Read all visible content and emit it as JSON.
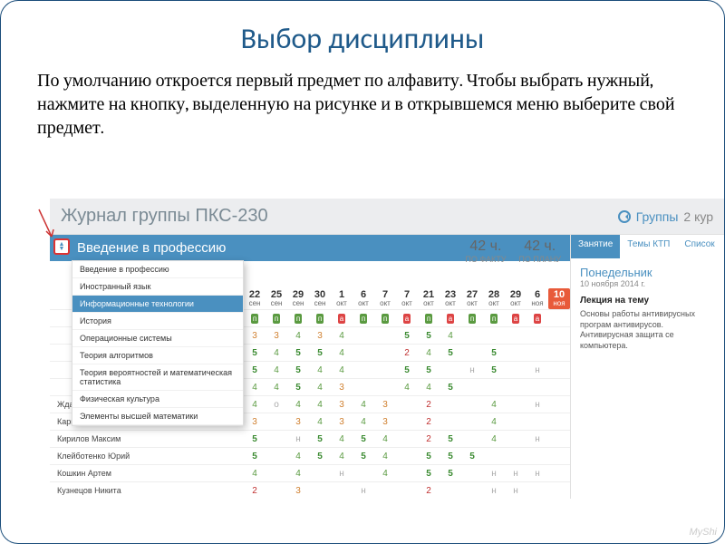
{
  "slide": {
    "title": "Выбор дисциплины",
    "description": "По умолчанию откроется первый предмет по алфавиту. Чтобы выбрать нужный, нажмите на кнопку, выделенную на рисунке и в открывшемся меню выберите свой предмет."
  },
  "app": {
    "journal_title": "Журнал группы ПКС-230",
    "breadcrumb_groups": "Группы",
    "breadcrumb_course": "2 кур",
    "subject_bar": "Введение в профессию",
    "hours": {
      "fact_value": "42 ч.",
      "fact_label": "ПО ФАКТУ",
      "plan_value": "42 ч.",
      "plan_label": "ПО ПЛАНУ"
    }
  },
  "dropdown": {
    "items": [
      {
        "label": "Введение в профессию",
        "selected": false
      },
      {
        "label": "Иностранный язык",
        "selected": false
      },
      {
        "label": "Информационные технологии",
        "selected": true
      },
      {
        "label": "История",
        "selected": false
      },
      {
        "label": "Операционные системы",
        "selected": false
      },
      {
        "label": "Теория алгоритмов",
        "selected": false
      },
      {
        "label": "Теория вероятностей и математическая статистика",
        "selected": false
      },
      {
        "label": "Физическая культура",
        "selected": false
      },
      {
        "label": "Элементы высшей математики",
        "selected": false
      }
    ]
  },
  "dates": [
    {
      "d": "22",
      "m": "сен"
    },
    {
      "d": "25",
      "m": "сен"
    },
    {
      "d": "29",
      "m": "сен"
    },
    {
      "d": "30",
      "m": "сен"
    },
    {
      "d": "1",
      "m": "окт"
    },
    {
      "d": "6",
      "m": "окт"
    },
    {
      "d": "7",
      "m": "окт"
    },
    {
      "d": "7",
      "m": "окт"
    },
    {
      "d": "21",
      "m": "окт"
    },
    {
      "d": "23",
      "m": "окт"
    },
    {
      "d": "27",
      "m": "окт"
    },
    {
      "d": "28",
      "m": "окт"
    },
    {
      "d": "29",
      "m": "окт"
    },
    {
      "d": "6",
      "m": "ноя"
    },
    {
      "d": "10",
      "m": "ноя",
      "hl": true
    }
  ],
  "flag_row": [
    "1",
    "1",
    "1",
    "1",
    "0",
    "1",
    "1",
    "0",
    "1",
    "0",
    "1",
    "1",
    "0",
    "0"
  ],
  "grade_rows": [
    {
      "name": "",
      "cells": [
        "3",
        "3",
        "4",
        "3",
        "4",
        "",
        "",
        "5",
        "5",
        "4",
        "",
        "",
        "",
        ""
      ]
    },
    {
      "name": "",
      "cells": [
        "5",
        "4",
        "5",
        "5",
        "4",
        "",
        "",
        "2",
        "4",
        "5",
        "",
        "5",
        "",
        ""
      ]
    },
    {
      "name": "",
      "cells": [
        "5",
        "4",
        "5",
        "4",
        "4",
        "",
        "",
        "5",
        "5",
        "",
        "н",
        "5",
        "",
        "н"
      ]
    },
    {
      "name": "",
      "cells": [
        "4",
        "4",
        "5",
        "4",
        "3",
        "",
        "",
        "4",
        "4",
        "5",
        "",
        "",
        "",
        ""
      ]
    },
    {
      "name": "Жданов Сергей",
      "cells": [
        "4",
        "о",
        "4",
        "4",
        "3",
        "4",
        "3",
        "",
        "2",
        "",
        "",
        "4",
        "",
        "н"
      ]
    },
    {
      "name": "Карпов Владимир",
      "cells": [
        "3",
        "",
        "3",
        "4",
        "3",
        "4",
        "3",
        "",
        "2",
        "",
        "",
        "4",
        "",
        ""
      ]
    },
    {
      "name": "Кирилов Максим",
      "cells": [
        "5",
        "",
        "н",
        "5",
        "4",
        "5",
        "4",
        "",
        "2",
        "5",
        "",
        "4",
        "",
        "н"
      ]
    },
    {
      "name": "Клейботенко Юрий",
      "cells": [
        "5",
        "",
        "4",
        "5",
        "4",
        "5",
        "4",
        "",
        "5",
        "5",
        "5",
        "",
        "",
        ""
      ]
    },
    {
      "name": "Кошкин Артем",
      "cells": [
        "4",
        "",
        "4",
        "",
        "н",
        "",
        "4",
        "",
        "5",
        "5",
        "",
        "н",
        "н",
        "н"
      ]
    },
    {
      "name": "Кузнецов Никита",
      "cells": [
        "2",
        "",
        "3",
        "",
        "",
        "н",
        "",
        "",
        "2",
        "",
        "",
        "н",
        "н",
        ""
      ]
    }
  ],
  "right": {
    "tabs": [
      {
        "label": "Занятие",
        "active": true
      },
      {
        "label": "Темы КТП",
        "active": false
      },
      {
        "label": "Список",
        "active": false
      }
    ],
    "day_name": "Понедельник",
    "day_date": "10 ноября 2014 г.",
    "lecture_title": "Лекция на тему",
    "lecture_desc": "Основы работы антивирусных програм антивирусов. Антивирусная защита се компьютера."
  },
  "watermark": "MyShi"
}
